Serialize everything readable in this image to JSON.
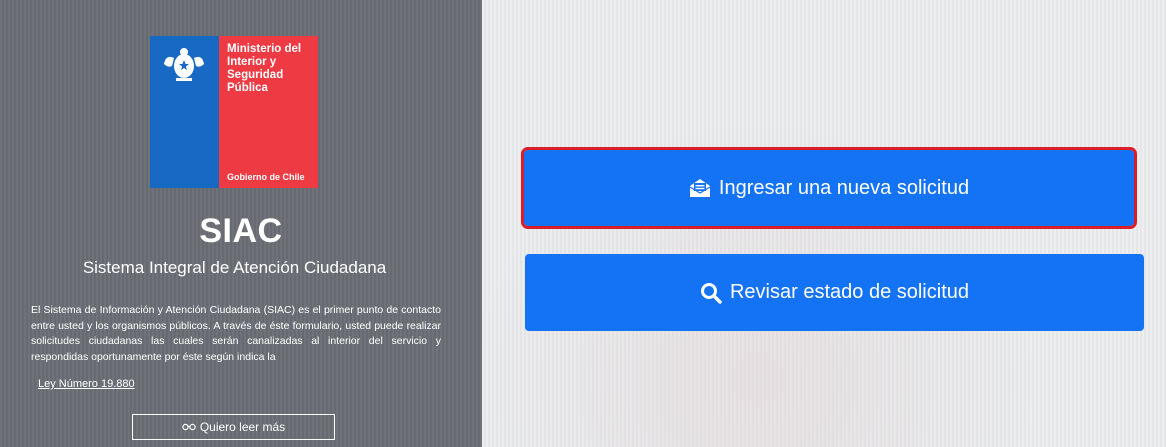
{
  "logo": {
    "ministry": "Ministerio del\nInterior y\nSeguridad\nPública",
    "government": "Gobierno de Chile"
  },
  "header": {
    "title": "SIAC",
    "subtitle": "Sistema Integral de Atención Ciudadana"
  },
  "description": "El Sistema de Información y Atención Ciudadana (SIAC) es el primer punto de contacto entre usted y los organismos públicos. A través de éste formulario, usted puede realizar solicitudes ciudadanas las cuales serán canalizadas al interior del servicio y respondidas oportunamente por éste según indica la",
  "law_link": "Ley Número 19.880",
  "read_more": "Quiero leer más",
  "actions": {
    "new_request": "Ingresar una nueva solicitud",
    "check_status": "Revisar estado de solicitud"
  },
  "colors": {
    "primary": "#1473f5",
    "highlight": "#d91e2a",
    "logo_blue": "#1769c4",
    "logo_red": "#ee3a43"
  }
}
